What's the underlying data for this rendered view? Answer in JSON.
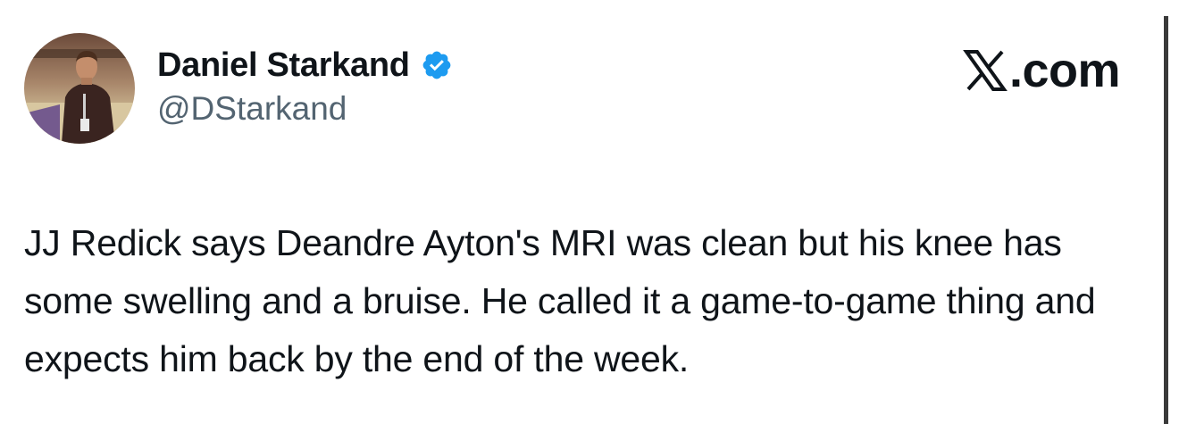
{
  "author": {
    "display_name": "Daniel Starkand",
    "handle": "@DStarkand",
    "verified": true,
    "avatar_icon": "profile-photo"
  },
  "brand": {
    "label": ".com",
    "logo_icon": "x-logo-icon"
  },
  "tweet": {
    "text": "JJ Redick says Deandre Ayton's MRI was clean but his knee has some swelling and a bruise. He called it a game-to-game thing and expects him back by the end of the week."
  },
  "colors": {
    "verified_blue": "#1d9bf0",
    "text_primary": "#0f1419",
    "text_secondary": "#536471"
  }
}
